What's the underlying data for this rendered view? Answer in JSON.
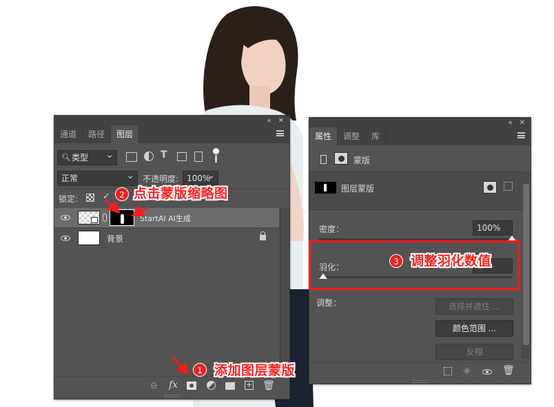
{
  "layers_panel": {
    "tabs": [
      {
        "label": "通道",
        "active": false
      },
      {
        "label": "路径",
        "active": false
      },
      {
        "label": "图层",
        "active": true
      }
    ],
    "filter_kind": "类型",
    "blend_mode": "正常",
    "opacity_label": "不透明度:",
    "opacity_value": "100%",
    "lock_label": "锁定:",
    "layers": [
      {
        "name": "StartAI AI生成",
        "selected": true,
        "has_mask": true
      },
      {
        "name": "背景",
        "selected": false,
        "locked": true
      }
    ],
    "footer_icons": [
      "link-icon",
      "fx-icon",
      "add-mask-icon",
      "adjustment-icon",
      "folder-icon",
      "new-layer-icon",
      "trash-icon"
    ],
    "fx_label": "fx"
  },
  "properties_panel": {
    "tabs": [
      {
        "label": "属性",
        "active": true
      },
      {
        "label": "调整",
        "active": false
      },
      {
        "label": "库",
        "active": false
      }
    ],
    "header_label": "蒙版",
    "mask_type_label": "图层蒙版",
    "density_label": "密度：",
    "density_value": "100%",
    "density": 1.0,
    "feather_label": "羽化：",
    "feather": 0.0,
    "refine_label": "调整：",
    "buttons": {
      "select_and_mask": "选择并遮住 ...",
      "color_range": "颜色范围 ...",
      "invert": "反相"
    }
  },
  "annotations": {
    "step1": {
      "number": "1",
      "text": "添加图层蒙版"
    },
    "step2": {
      "number": "2",
      "text": "点击蒙版缩略图"
    },
    "step3": {
      "number": "3",
      "text": "调整羽化数值"
    }
  },
  "colors": {
    "panel_bg": "#535353",
    "annotation_red": "#ff2020"
  }
}
